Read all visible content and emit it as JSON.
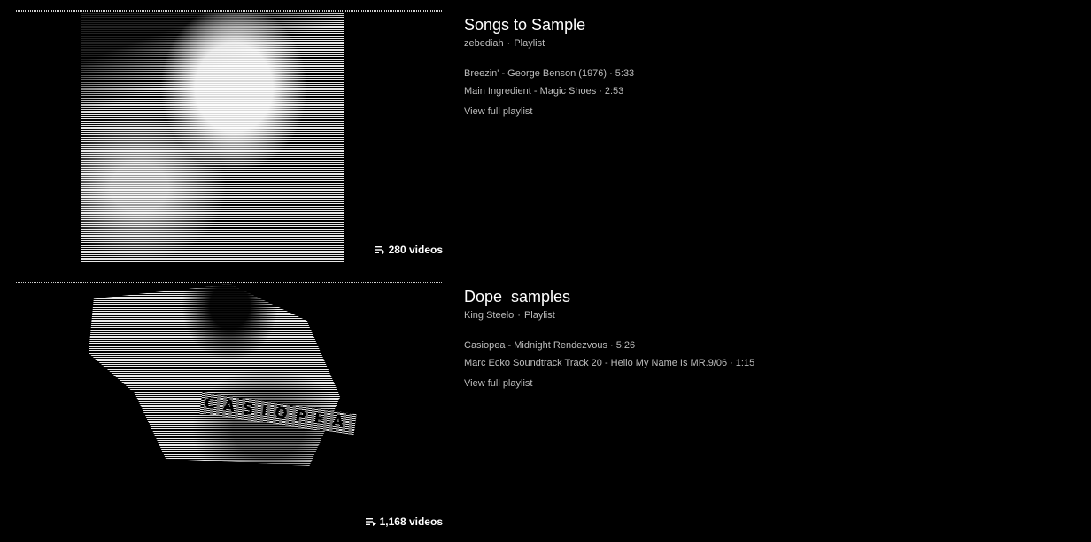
{
  "results": [
    {
      "title": "Songs to Sample",
      "channel": "zebediah",
      "separator": "·",
      "type": "Playlist",
      "video_count": "280 videos",
      "tracks": [
        {
          "name": "Breezin' - George Benson (1976)",
          "duration": "5:33"
        },
        {
          "name": "Main Ingredient - Magic Shoes",
          "duration": "2:53"
        }
      ],
      "view_full": "View full playlist"
    },
    {
      "title": "Dope  samples",
      "channel": "King Steelo",
      "separator": "·",
      "type": "Playlist",
      "video_count": "1,168 videos",
      "tracks": [
        {
          "name": "Casiopea - Midnight Rendezvous",
          "duration": "5:26"
        },
        {
          "name": "Marc Ecko Soundtrack Track 20 - Hello My Name Is MR.9/06",
          "duration": "1:15"
        }
      ],
      "view_full": "View full playlist",
      "thumbnail_text": "CASIOPEA"
    }
  ],
  "icons": {
    "playlist": "playlist-icon"
  },
  "colors": {
    "background": "#000000",
    "title": "#ffffff",
    "secondary_text": "#bdbdbd"
  }
}
